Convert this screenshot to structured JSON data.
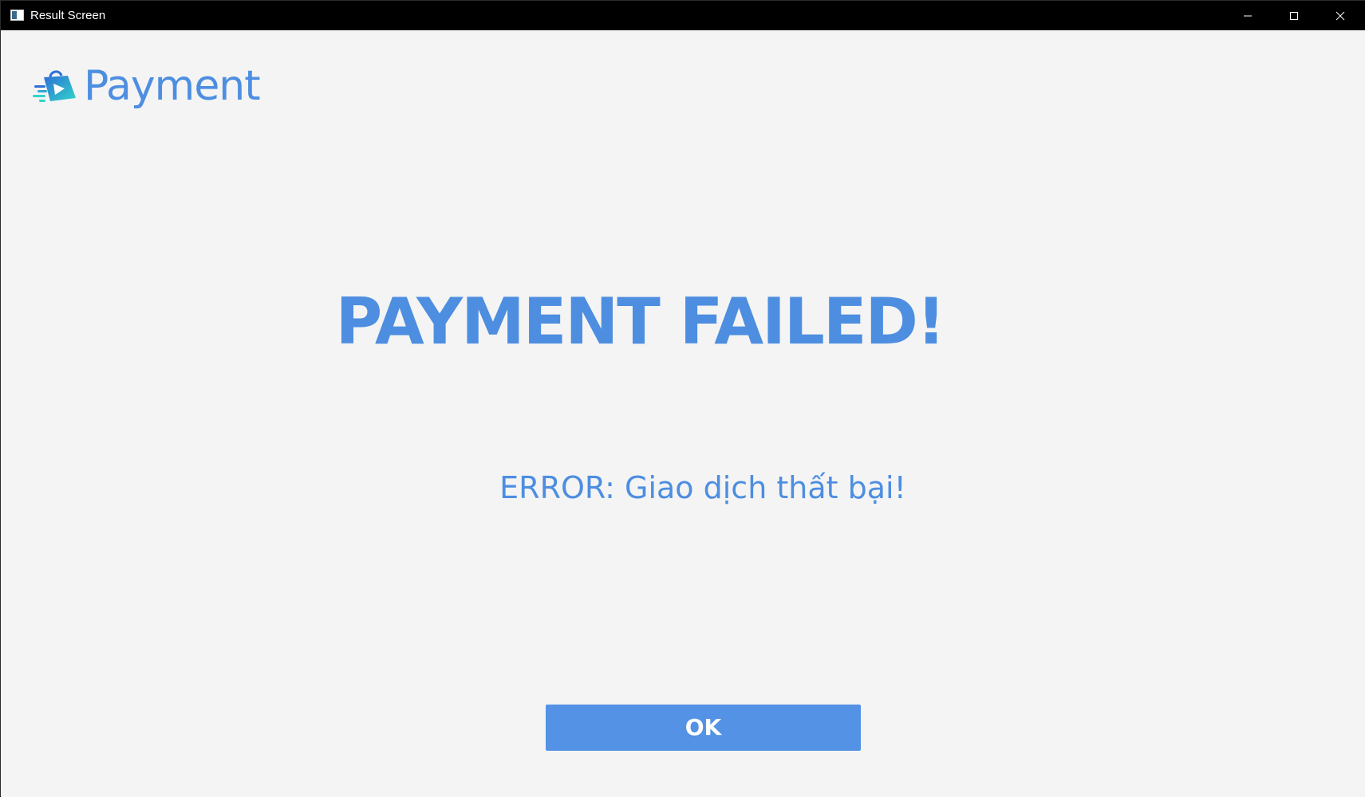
{
  "window": {
    "title": "Result Screen"
  },
  "header": {
    "brand": "Payment"
  },
  "main": {
    "headline": "PAYMENT FAILED!",
    "error_message": "ERROR: Giao dịch thất bại!",
    "ok_label": "OK"
  },
  "colors": {
    "accent": "#4d8ee0",
    "button": "#5392e5",
    "background": "#f4f4f4",
    "titlebar": "#000000"
  },
  "icons": {
    "app": "app-window-icon",
    "logo": "shopping-bag-icon",
    "minimize": "minimize-icon",
    "maximize": "maximize-icon",
    "close": "close-icon"
  }
}
